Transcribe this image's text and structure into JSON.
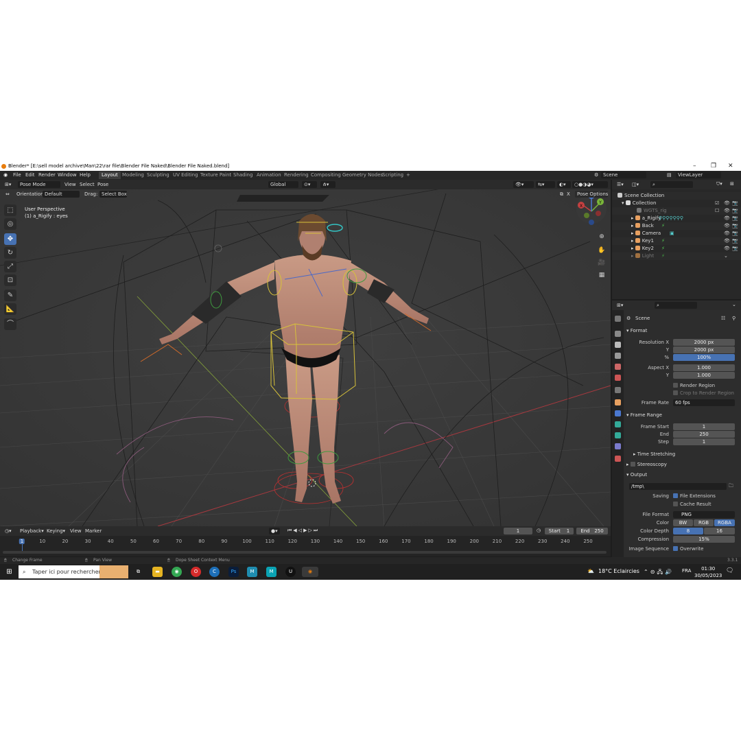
{
  "window": {
    "title": "Blender* [E:\\sell model archive\\Man\\22\\rar file\\Blender File Naked\\Blender File Naked.blend]",
    "minimize": "–",
    "maximize": "❐",
    "close": "✕"
  },
  "menu": [
    "File",
    "Edit",
    "Render",
    "Window",
    "Help"
  ],
  "workspaces": [
    "Layout",
    "Modeling",
    "Sculpting",
    "UV Editing",
    "Texture Paint",
    "Shading",
    "Animation",
    "Rendering",
    "Compositing",
    "Geometry Nodes",
    "Scripting"
  ],
  "workspace_add": "+",
  "scene_name": "Scene",
  "view_layer": "ViewLayer",
  "viewport_header": {
    "mode": "Pose Mode",
    "view": "View",
    "select": "Select",
    "pose": "Pose",
    "transform": "Global",
    "orientation_label": "Orientation:",
    "orientation_value": "Default",
    "drag_label": "Drag:",
    "drag_value": "Select Box",
    "pose_options": "Pose Options",
    "x_label": "X"
  },
  "viewport_overlay": {
    "perspective": "User Perspective",
    "object": "(1) a_Rigify : eyes"
  },
  "gizmo": {
    "x": "X",
    "y": "Y",
    "z": "Z"
  },
  "outliner": {
    "root": "Scene Collection",
    "collection": "Collection",
    "items": [
      {
        "name": "WGTS_rig",
        "dim": true
      },
      {
        "name": "a_Rigify",
        "dim": false
      },
      {
        "name": "Back",
        "dim": false
      },
      {
        "name": "Camera",
        "dim": false
      },
      {
        "name": "Key1",
        "dim": false
      },
      {
        "name": "Key2",
        "dim": false
      },
      {
        "name": "Light",
        "dim": true
      }
    ]
  },
  "properties": {
    "scene": "Scene",
    "format": {
      "title": "Format",
      "resolution_x_label": "Resolution X",
      "resolution_x": "2000 px",
      "y_label": "Y",
      "resolution_y": "2000 px",
      "percent_label": "%",
      "percent": "100%",
      "aspect_x_label": "Aspect X",
      "aspect_x": "1.000",
      "aspect_y_label": "Y",
      "aspect_y": "1.000",
      "render_region": "Render Region",
      "crop_region": "Crop to Render Region",
      "frame_rate_label": "Frame Rate",
      "frame_rate": "60 fps"
    },
    "frame_range": {
      "title": "Frame Range",
      "start_label": "Frame Start",
      "start": "1",
      "end_label": "End",
      "end": "250",
      "step_label": "Step",
      "step": "1"
    },
    "time_stretching": "Time Stretching",
    "stereoscopy": "Stereoscopy",
    "output": {
      "title": "Output",
      "path": "/tmp\\",
      "saving_label": "Saving",
      "file_extensions": "File Extensions",
      "cache_result": "Cache Result",
      "file_format_label": "File Format",
      "file_format": "PNG",
      "color_label": "Color",
      "color_options": [
        "BW",
        "RGB",
        "RGBA"
      ],
      "color_depth_label": "Color Depth",
      "color_depth_options": [
        "8",
        "16"
      ],
      "compression_label": "Compression",
      "compression": "15%",
      "image_sequence_label": "Image Sequence",
      "overwrite": "Overwrite"
    }
  },
  "timeline": {
    "playback": "Playback",
    "keying": "Keying",
    "view": "View",
    "marker": "Marker",
    "current_frame": "1",
    "start_label": "Start",
    "start": "1",
    "end_label": "End",
    "end": "250",
    "ticks": [
      "1",
      "10",
      "20",
      "30",
      "40",
      "50",
      "60",
      "70",
      "80",
      "90",
      "100",
      "110",
      "120",
      "130",
      "140",
      "150",
      "160",
      "170",
      "180",
      "190",
      "200",
      "210",
      "220",
      "230",
      "240",
      "250"
    ]
  },
  "statusbar": {
    "change_frame": "Change Frame",
    "pan_view": "Pan View",
    "context_menu": "Dope Sheet Context Menu",
    "version": "3.3.1"
  },
  "taskbar": {
    "search_placeholder": "Taper ici pour rechercher",
    "weather": "18°C  Eclaircies",
    "language": "FRA",
    "time": "01:30",
    "date": "30/05/2023"
  },
  "colors": {
    "accent": "#4772b3",
    "blender_orange": "#e87d0d",
    "viewport_bg": "#3a3a3a"
  }
}
